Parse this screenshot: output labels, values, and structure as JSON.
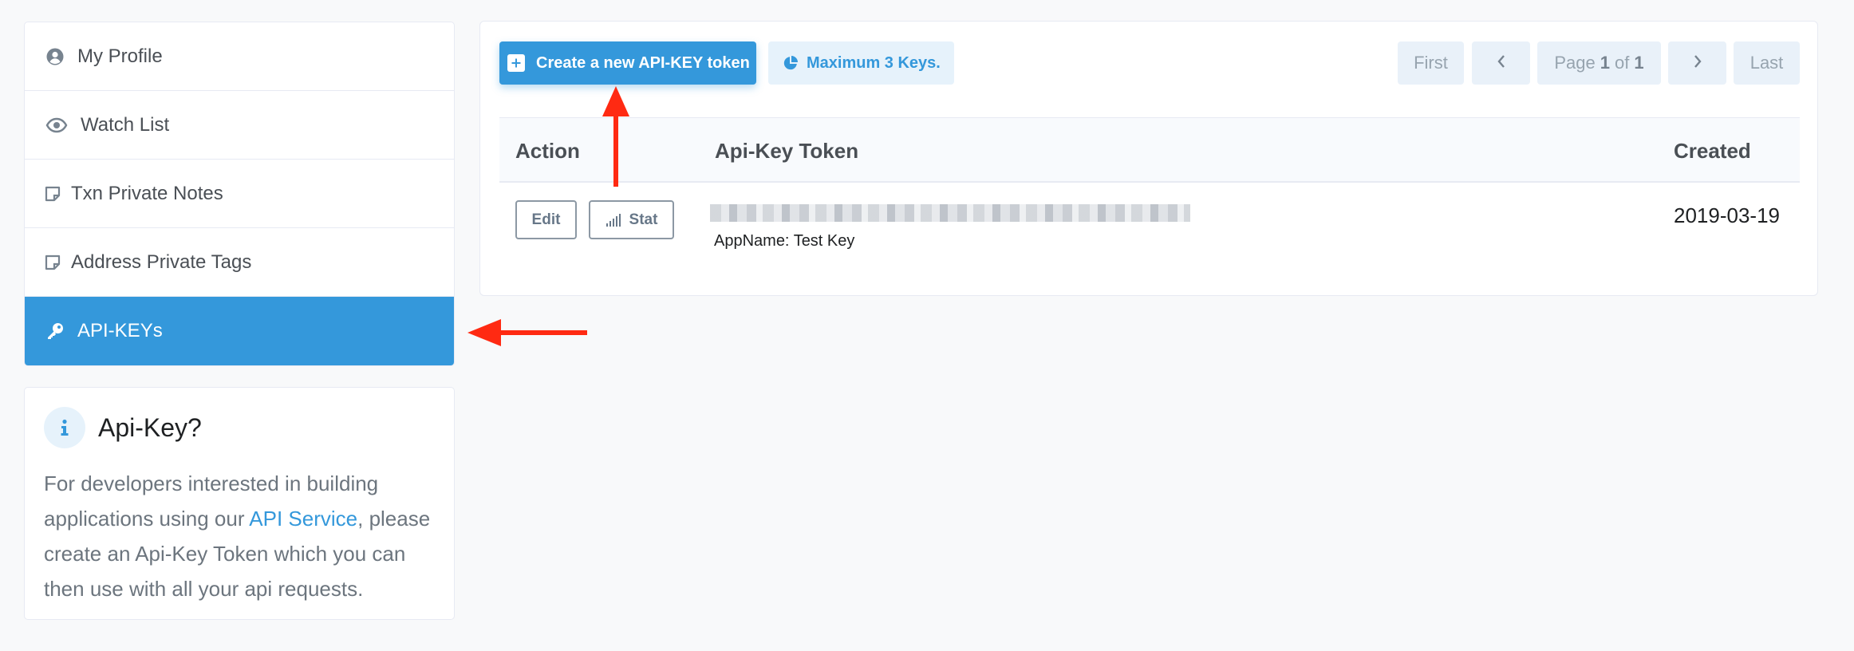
{
  "sidebar": {
    "items": [
      {
        "label": "My Profile",
        "icon": "user-circle-icon"
      },
      {
        "label": "Watch List",
        "icon": "eye-icon"
      },
      {
        "label": "Txn Private Notes",
        "icon": "sticky-note-icon"
      },
      {
        "label": "Address Private Tags",
        "icon": "sticky-note-icon"
      },
      {
        "label": "API-KEYs",
        "icon": "key-icon",
        "active": true
      }
    ]
  },
  "info": {
    "icon": "info-icon",
    "title": "Api-Key?",
    "text_before": "For developers interested in building applications using our ",
    "link": "API Service",
    "text_after": ", please create an Api-Key Token which you can then use with all your api requests."
  },
  "toolbar": {
    "create_label": "Create a new API-KEY token",
    "max_label": "Maximum 3 Keys."
  },
  "pagination": {
    "first": "First",
    "prev_icon": "chevron-left-icon",
    "page_prefix": "Page",
    "page_current": "1",
    "page_of": "of",
    "page_total": "1",
    "next_icon": "chevron-right-icon",
    "last": "Last"
  },
  "table": {
    "headers": {
      "action": "Action",
      "token": "Api-Key Token",
      "created": "Created"
    },
    "rows": [
      {
        "edit": "Edit",
        "stat": "Stat",
        "appname": "AppName: Test Key",
        "created": "2019-03-19"
      }
    ]
  },
  "colors": {
    "primary": "#3498db",
    "annotation_arrow": "#ff2a12",
    "background": "#f8f9fa"
  }
}
